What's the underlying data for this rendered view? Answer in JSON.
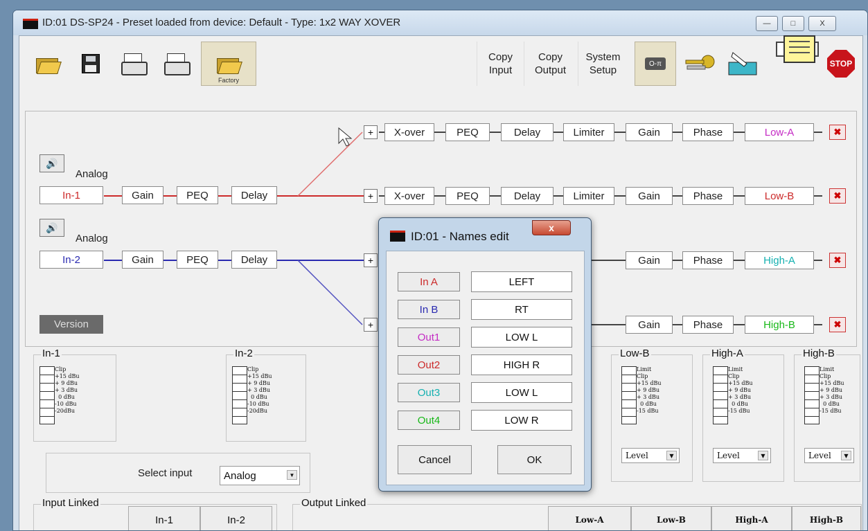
{
  "window": {
    "title": "ID:01 DS-SP24 - Preset loaded from device: Default - Type: 1x2 WAY XOVER",
    "min": "—",
    "max": "□",
    "close": "X"
  },
  "toolbar": {
    "factory_label": "Factory",
    "copy_input": [
      "Copy",
      "Input"
    ],
    "copy_output": [
      "Copy",
      "Output"
    ],
    "system_setup": [
      "System",
      "Setup"
    ],
    "stop": "STOP",
    "key": "O-π"
  },
  "routing": {
    "inputs": [
      {
        "type": "Analog",
        "name": "In-1",
        "color": "#cc2a2a"
      },
      {
        "type": "Analog",
        "name": "In-2",
        "color": "#2a2ab0"
      }
    ],
    "chain_in": [
      "Gain",
      "PEQ",
      "Delay"
    ],
    "chain_out": [
      "X-over",
      "PEQ",
      "Delay",
      "Limiter",
      "Gain",
      "Phase"
    ],
    "outputs": [
      {
        "name": "Low-A",
        "color": "#c42bc4"
      },
      {
        "name": "Low-B",
        "color": "#cc2a2a"
      },
      {
        "name": "High-A",
        "color": "#15b0b0"
      },
      {
        "name": "High-B",
        "color": "#18b818"
      }
    ],
    "plus": "+",
    "version": "Version"
  },
  "meters": {
    "in1": {
      "title": "In-1",
      "scale": "Clip\n+15 dBu\n+ 9 dBu\n+ 3 dBu\n  0 dBu\n-10 dBu\n-20dBu"
    },
    "in2": {
      "title": "In-2",
      "scale": "Clip\n+15 dBu\n+ 9 dBu\n+ 3 dBu\n  0 dBu\n-10 dBu\n-20dBu"
    },
    "outs": [
      {
        "title": "Low-B",
        "scale": "Limit\nClip\n+15 dBu\n+ 9 dBu\n+ 3 dBu\n  0 dBu\n-15 dBu",
        "select": "Level"
      },
      {
        "title": "High-A",
        "scale": "Limit\nClip\n+15 dBu\n+ 9 dBu\n+ 3 dBu\n  0 dBu\n-15 dBu",
        "select": "Level"
      },
      {
        "title": "High-B",
        "scale": "Limit\nClip\n+15 dBu\n+ 9 dBu\n+ 3 dBu\n  0 dBu\n-15 dBu",
        "select": "Level"
      }
    ],
    "select_input_label": "Select input",
    "select_input_value": "Analog"
  },
  "links": {
    "input_title": "Input Linked",
    "inputs": [
      "In-1",
      "In-2"
    ],
    "output_title": "Output Linked",
    "outputs": [
      "Low-A",
      "Low-B",
      "High-A",
      "High-B"
    ]
  },
  "dialog": {
    "title": "ID:01 - Names edit",
    "close": "x",
    "rows": [
      {
        "label": "In A",
        "value": "LEFT",
        "color": "#cc2a2a"
      },
      {
        "label": "In B",
        "value": "RT",
        "color": "#2a2ab0"
      },
      {
        "label": "Out1",
        "value": "LOW L",
        "color": "#c42bc4"
      },
      {
        "label": "Out2",
        "value": "HIGH R",
        "color": "#cc2a2a"
      },
      {
        "label": "Out3",
        "value": "LOW L",
        "color": "#15b0b0"
      },
      {
        "label": "Out4",
        "value": "LOW R",
        "color": "#18b818"
      }
    ],
    "cancel": "Cancel",
    "ok": "OK"
  }
}
